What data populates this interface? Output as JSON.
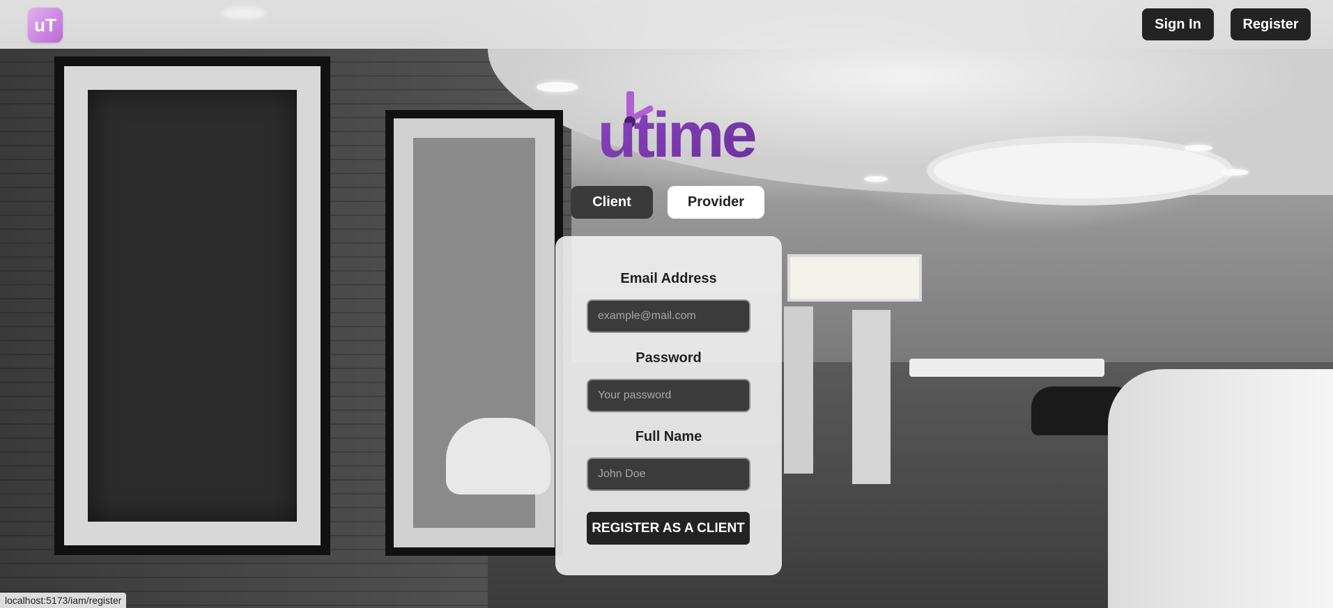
{
  "header": {
    "logo_text": "uT",
    "sign_in_label": "Sign In",
    "register_label": "Register"
  },
  "brand": {
    "name": "utime",
    "color": "#7b3fa8"
  },
  "tabs": [
    {
      "label": "Client",
      "active": true
    },
    {
      "label": "Provider",
      "active": false
    }
  ],
  "form": {
    "email_label": "Email Address",
    "email_placeholder": "example@mail.com",
    "email_value": "",
    "password_label": "Password",
    "password_placeholder": "Your password",
    "password_value": "",
    "fullname_label": "Full Name",
    "fullname_placeholder": "John Doe",
    "fullname_value": "",
    "submit_label": "REGISTER AS A CLIENT"
  },
  "status_bar": {
    "url": "localhost:5173/iam/register"
  }
}
